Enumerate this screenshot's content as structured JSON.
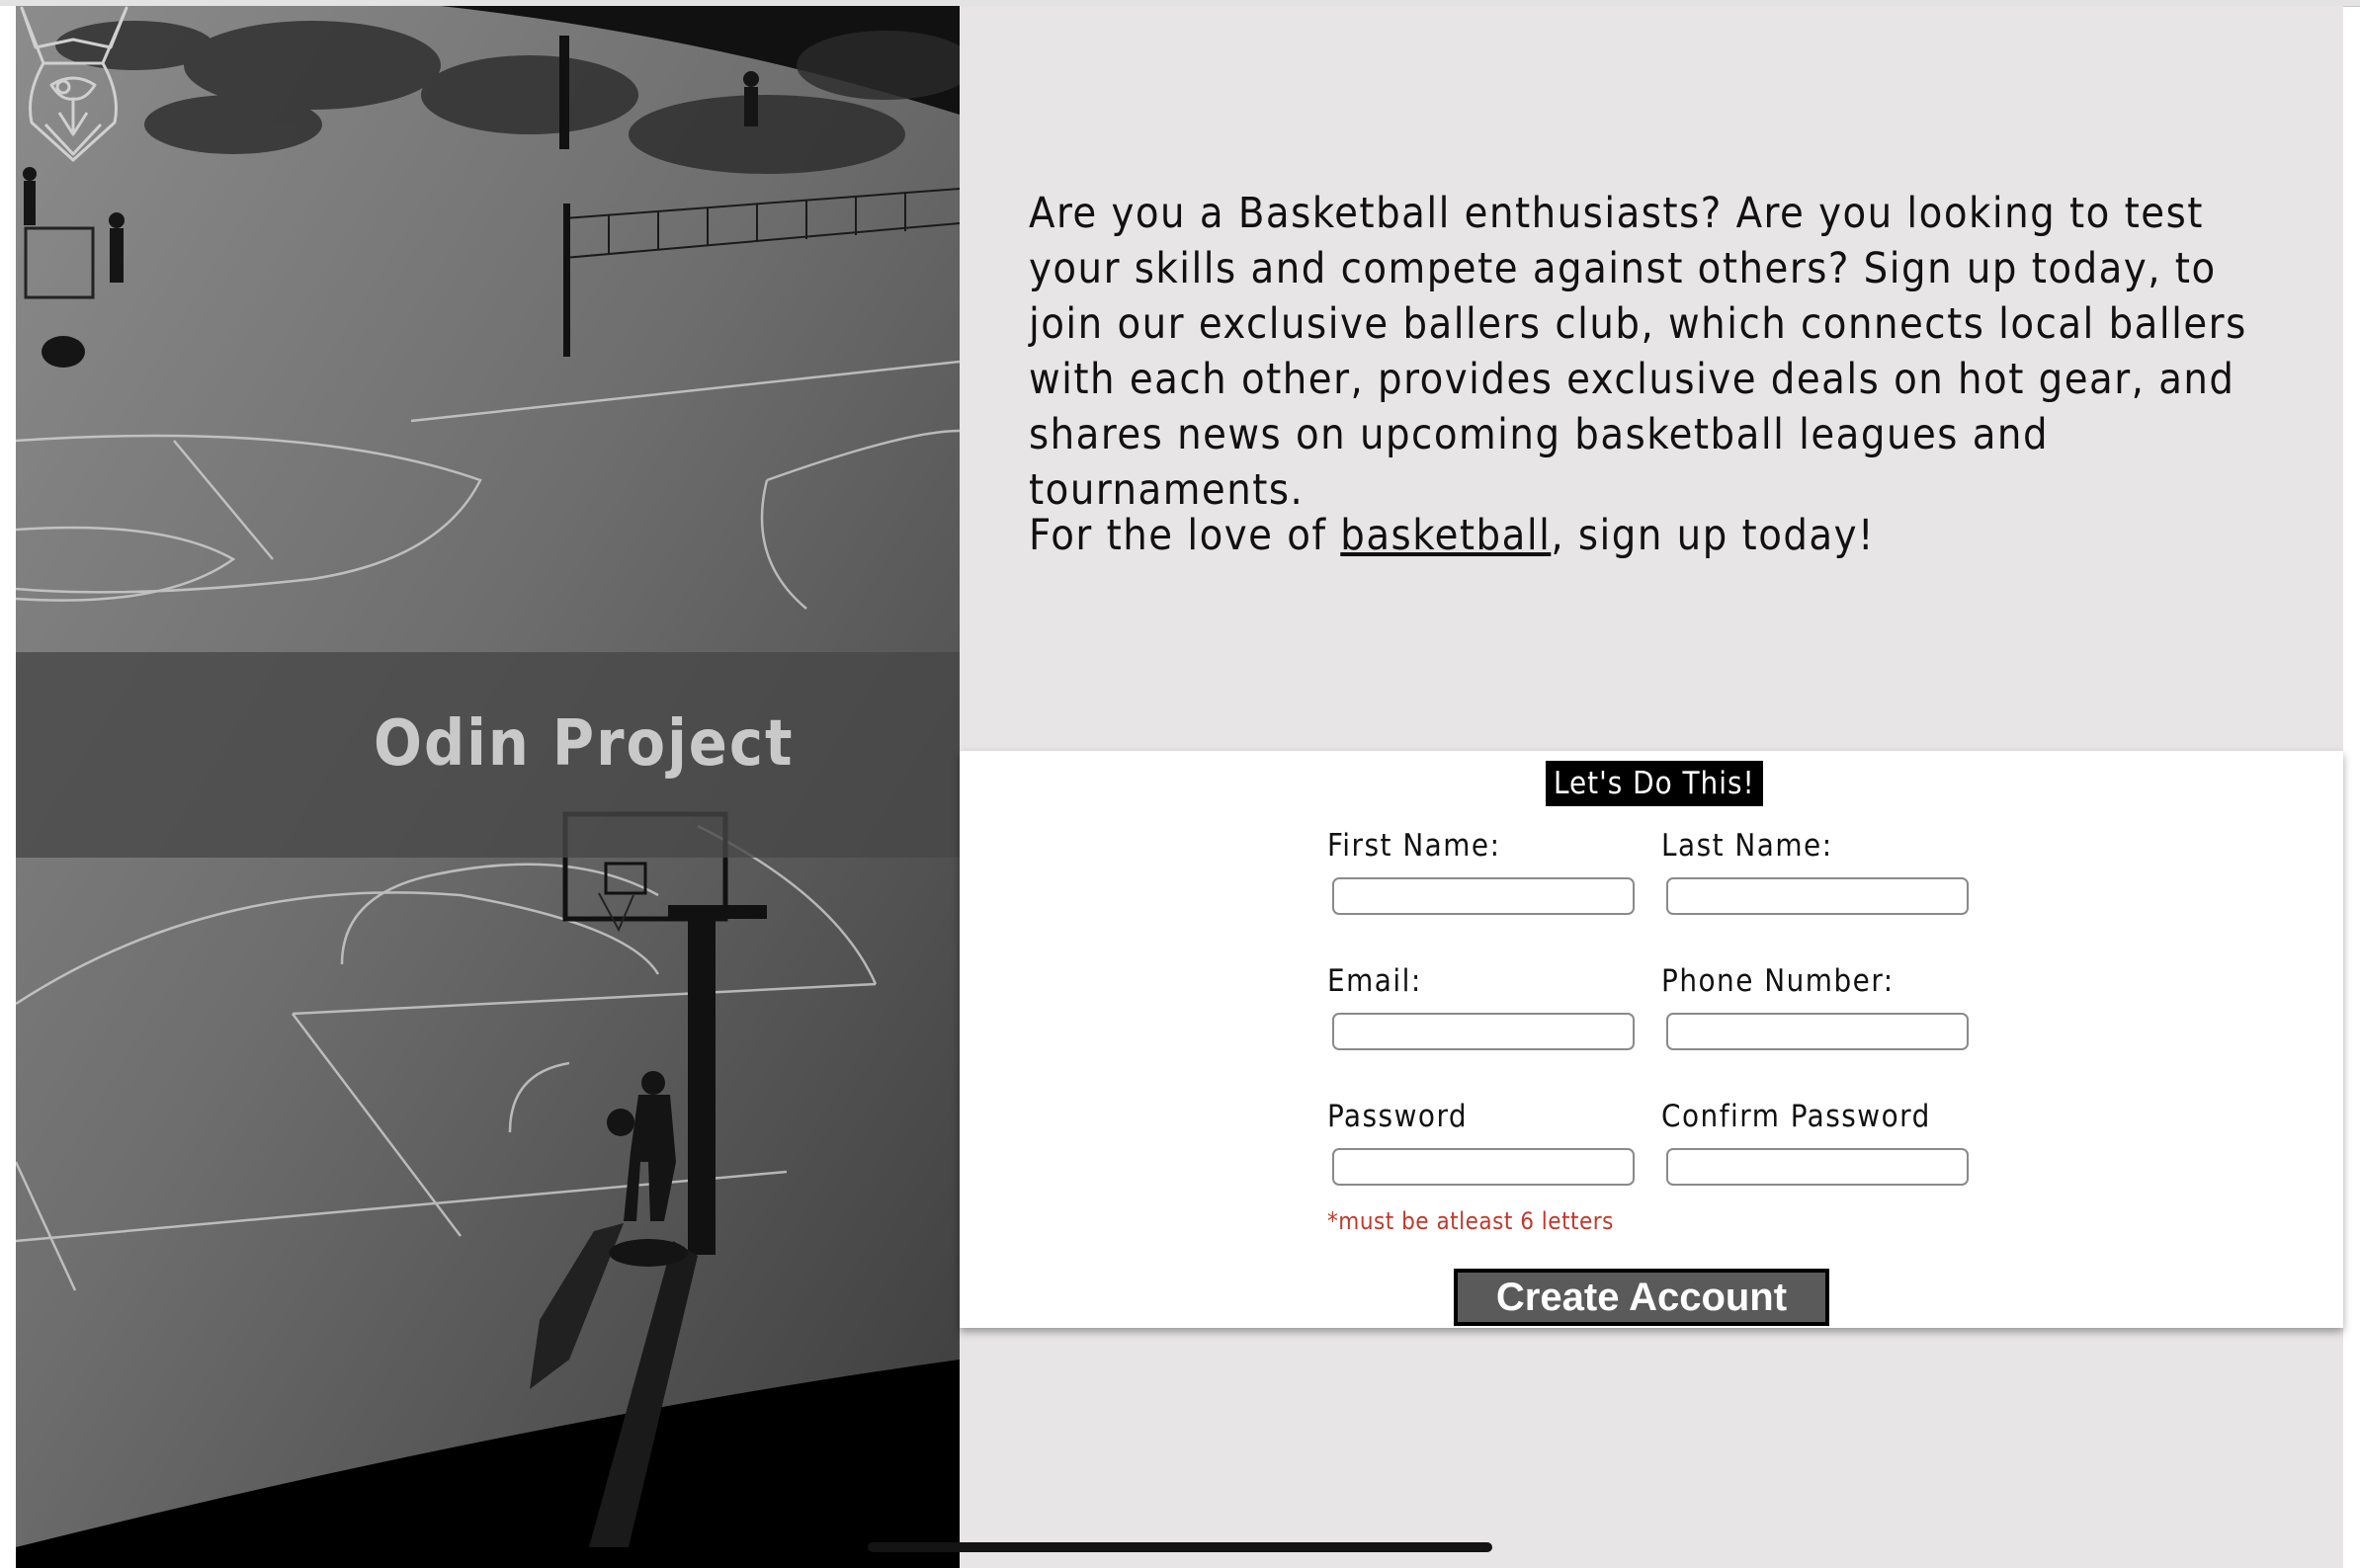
{
  "brand": {
    "name": "Odin Project",
    "logo_icon": "odin-viking-helmet-icon"
  },
  "intro": {
    "paragraph": "Are you a Basketball enthusiasts? Are you looking to test your skills and compete against others? Sign up today, to join our exclusive ballers club, which connects local ballers with each other, provides exclusive deals on hot gear, and shares news on upcoming basketball leagues and tournaments.",
    "love_prefix": "For the love of ",
    "love_link": "basketball",
    "love_suffix": ", sign up today!"
  },
  "form": {
    "title": "Let's Do This!",
    "first_name_label": "First Name:",
    "last_name_label": "Last Name:",
    "email_label": "Email:",
    "phone_label": "Phone Number:",
    "password_label": "Password",
    "confirm_password_label": "Confirm Password",
    "first_name_value": "",
    "last_name_value": "",
    "email_value": "",
    "phone_value": "",
    "password_value": "",
    "confirm_password_value": "",
    "password_hint": "*must be atleast 6 letters",
    "submit_label": "Create Account"
  },
  "colors": {
    "right_background": "#e7e5e6",
    "form_background": "#ffffff",
    "title_background": "#000000",
    "button_background": "#5a5a5a",
    "hint_text": "#c0392b"
  }
}
